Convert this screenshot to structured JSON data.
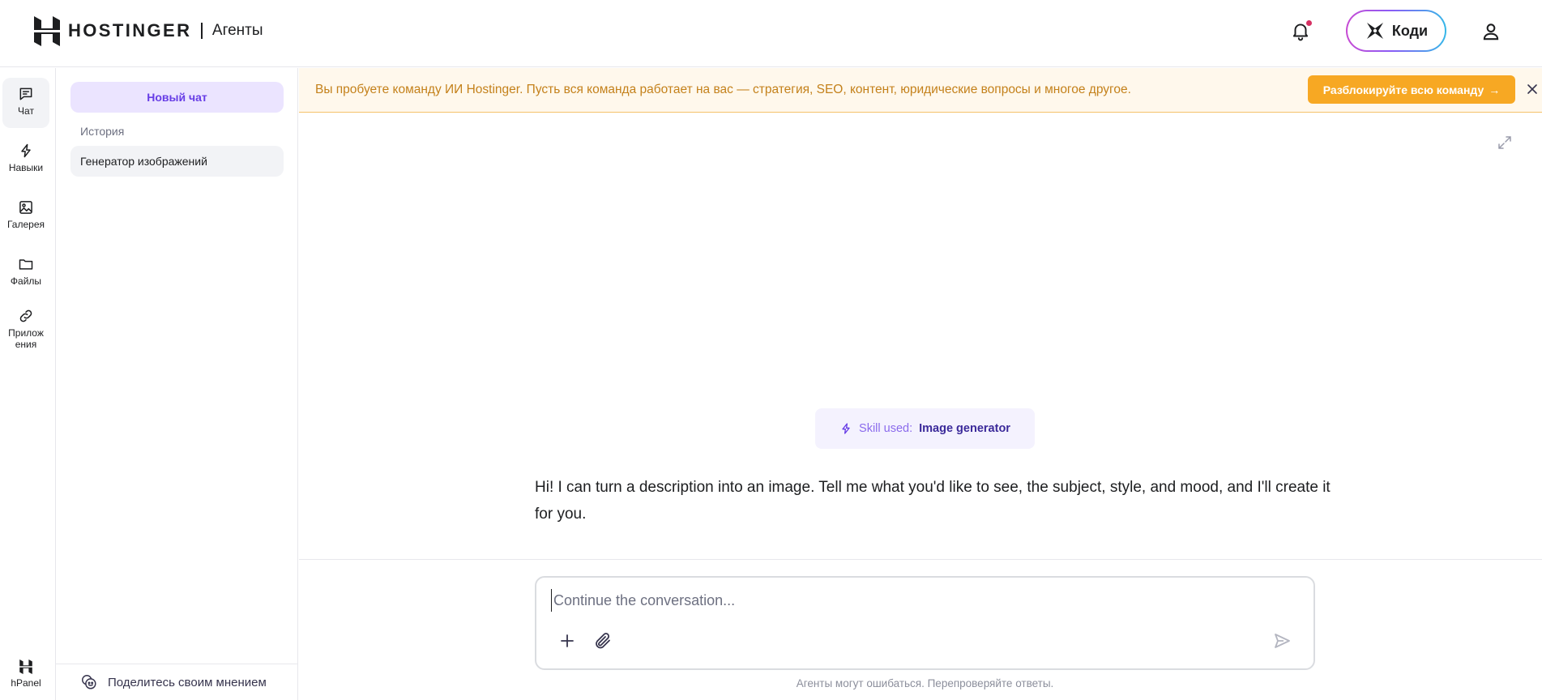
{
  "header": {
    "brand": "HOSTINGER",
    "product": "Агенты",
    "kodee_label": "Коди",
    "notification_dot_color": "#d63163"
  },
  "rail": {
    "items": [
      {
        "label": "Чат",
        "icon": "chat-bubble-icon",
        "active": true
      },
      {
        "label": "Навыки",
        "icon": "lightning-icon"
      },
      {
        "label": "Галерея",
        "icon": "image-icon"
      },
      {
        "label": "Файлы",
        "icon": "folder-icon"
      },
      {
        "label": "Прилож ения",
        "icon": "link-icon"
      }
    ],
    "bottom_label": "hPanel"
  },
  "sidebar": {
    "new_chat_label": "Новый чат",
    "history_label": "История",
    "history_items": [
      "Генератор изображений"
    ],
    "feedback_label": "Поделитесь своим мнением"
  },
  "banner": {
    "text": "Вы пробуете команду ИИ Hostinger. Пусть вся команда работает на вас — стратегия, SEO, контент, юридические вопросы и многое другое.",
    "button_label": "Разблокируйте всю команду",
    "button_arrow": "→",
    "accent_color": "#f7a823"
  },
  "chat": {
    "skill_prefix": "Skill used:",
    "skill_name": "Image generator",
    "message": "Hi! I can turn a description into an image. Tell me what you'd like to see, the subject, style, and mood, and I'll create it for you."
  },
  "composer": {
    "placeholder": "Continue the conversation...",
    "value": "",
    "disclaimer": "Агенты могут ошибаться. Перепроверяйте ответы."
  },
  "colors": {
    "brand_purple": "#673de6",
    "active_bg": "#ebe4ff"
  }
}
